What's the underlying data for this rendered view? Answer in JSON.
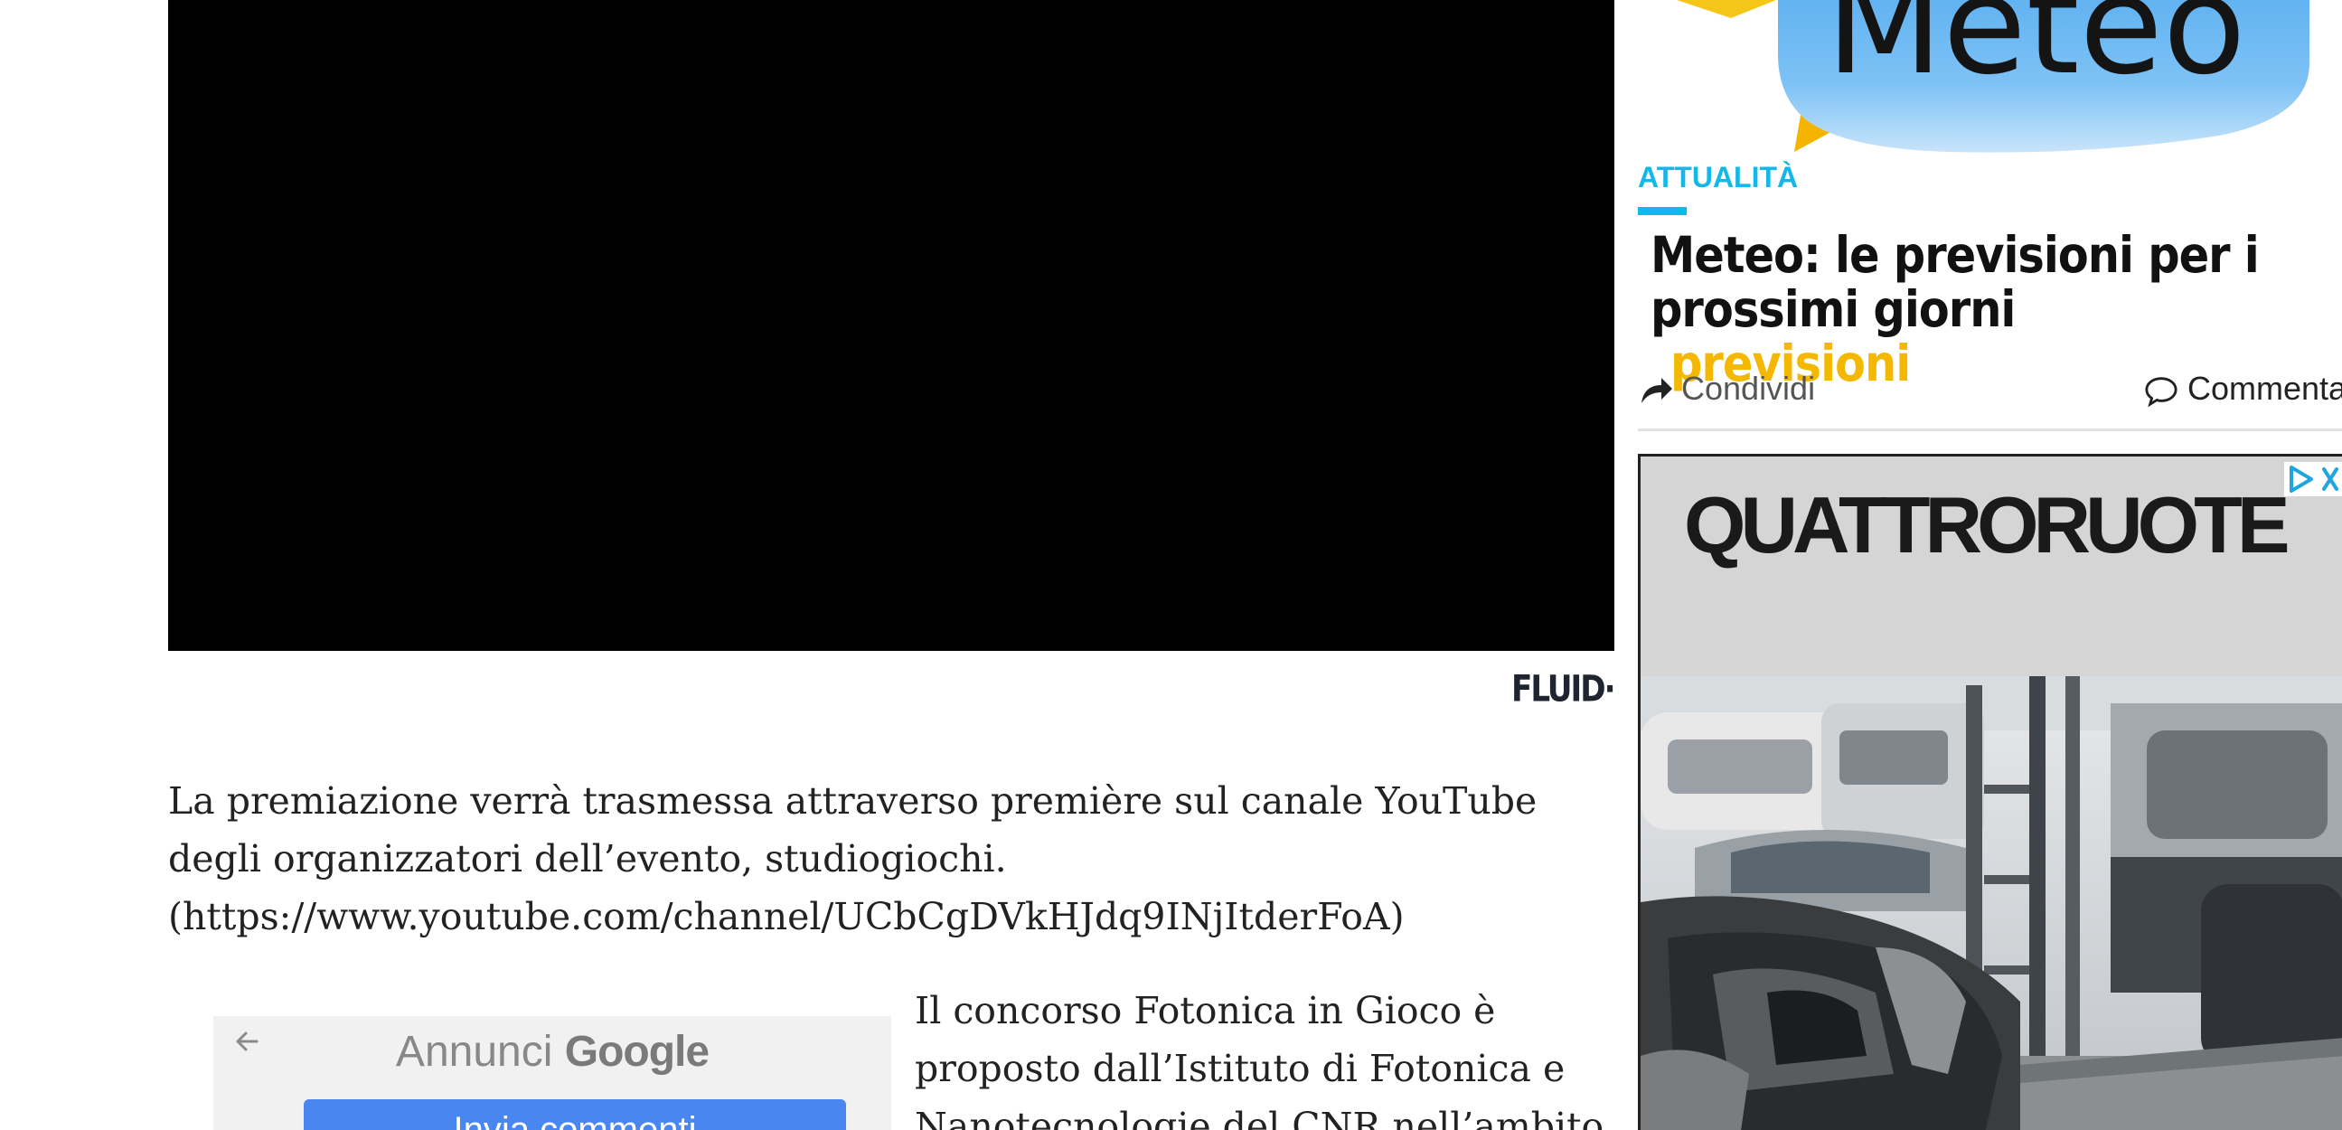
{
  "video": {
    "watermark": "FLUID·"
  },
  "article": {
    "paragraph_1": [
      "La premiazione verrà trasmessa attraverso première sul canale YouTube",
      "degli organizzatori dell’evento, studiogiochi.",
      "(https://www.youtube.com/channel/UCbCgDVkHJdq9INjItderFoA)"
    ],
    "paragraph_2": [
      "Il concorso Fotonica in Gioco è",
      "proposto dall’Istituto di Fotonica e",
      "Nanotecnologie del CNR nell’ambito"
    ]
  },
  "google_ad": {
    "label": "Annunci",
    "brand": "Google",
    "button_label": "Invia commenti"
  },
  "sidebar": {
    "image_text": "Meteo",
    "category": "ATTUALITÀ",
    "title_lines": [
      "Meteo: le previsioni per i",
      "prossimi giorni"
    ],
    "tag": "previsioni",
    "share_label": "Condividi",
    "comment_label": "Commenta",
    "ad": {
      "brand": "QUATTRORUOTE"
    }
  },
  "colors": {
    "accent_blue": "#13b8e8",
    "tag_yellow": "#f5b800",
    "button_blue": "#4a86f0"
  }
}
